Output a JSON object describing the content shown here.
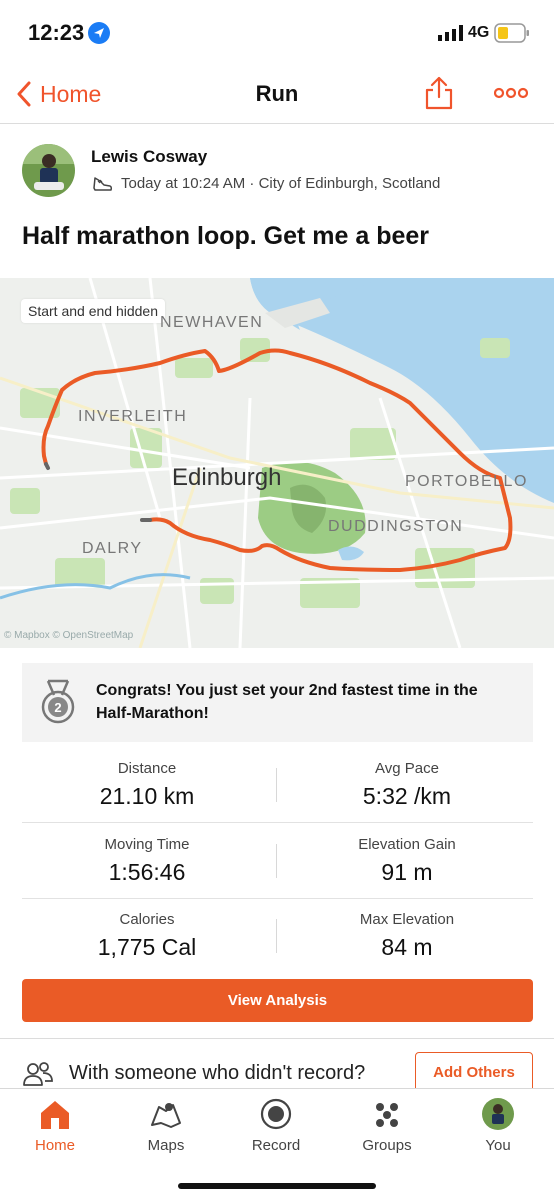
{
  "status_bar": {
    "time": "12:23",
    "network": "4G",
    "location_icon": "location-arrow-icon",
    "signal_icon": "signal-bars-icon",
    "battery_icon": "battery-low-icon"
  },
  "nav": {
    "back_label": "Home",
    "title": "Run",
    "share_icon": "share-icon",
    "more_icon": "more-dots-icon",
    "accent": "#f0542c"
  },
  "activity": {
    "athlete_name": "Lewis Cosway",
    "meta": "Today at 10:24 AM · City of Edinburgh, Scotland",
    "title": "Half marathon loop. Get me a beer",
    "sport_icon": "running-shoe-icon"
  },
  "map": {
    "tag": "Start and end hidden",
    "city": "Edinburgh",
    "places": [
      "NEWHAVEN",
      "INVERLEITH",
      "PORTOBELLO",
      "DUDDINGSTON",
      "DALRY"
    ],
    "attribution": "© Mapbox © OpenStreetMap",
    "route_color": "#ea5b26",
    "water_color": "#aad3ee"
  },
  "achievement": {
    "text": "Congrats! You just set your 2nd fastest time in the Half-Marathon!",
    "rank": "2",
    "icon": "medal-icon"
  },
  "stats": [
    {
      "label": "Distance",
      "value": "21.10 km"
    },
    {
      "label": "Avg Pace",
      "value": "5:32 /km"
    },
    {
      "label": "Moving Time",
      "value": "1:56:46"
    },
    {
      "label": "Elevation Gain",
      "value": "91 m"
    },
    {
      "label": "Calories",
      "value": "1,775 Cal"
    },
    {
      "label": "Max Elevation",
      "value": "84 m"
    }
  ],
  "analysis_button": "View Analysis",
  "others": {
    "text": "With someone who didn't record?",
    "button": "Add Others",
    "icon": "people-icon"
  },
  "tabs": [
    {
      "label": "Home",
      "icon": "home-icon",
      "active": true
    },
    {
      "label": "Maps",
      "icon": "map-icon",
      "active": false
    },
    {
      "label": "Record",
      "icon": "record-icon",
      "active": false
    },
    {
      "label": "Groups",
      "icon": "groups-icon",
      "active": false
    },
    {
      "label": "You",
      "icon": "profile-avatar-icon",
      "active": false
    }
  ]
}
